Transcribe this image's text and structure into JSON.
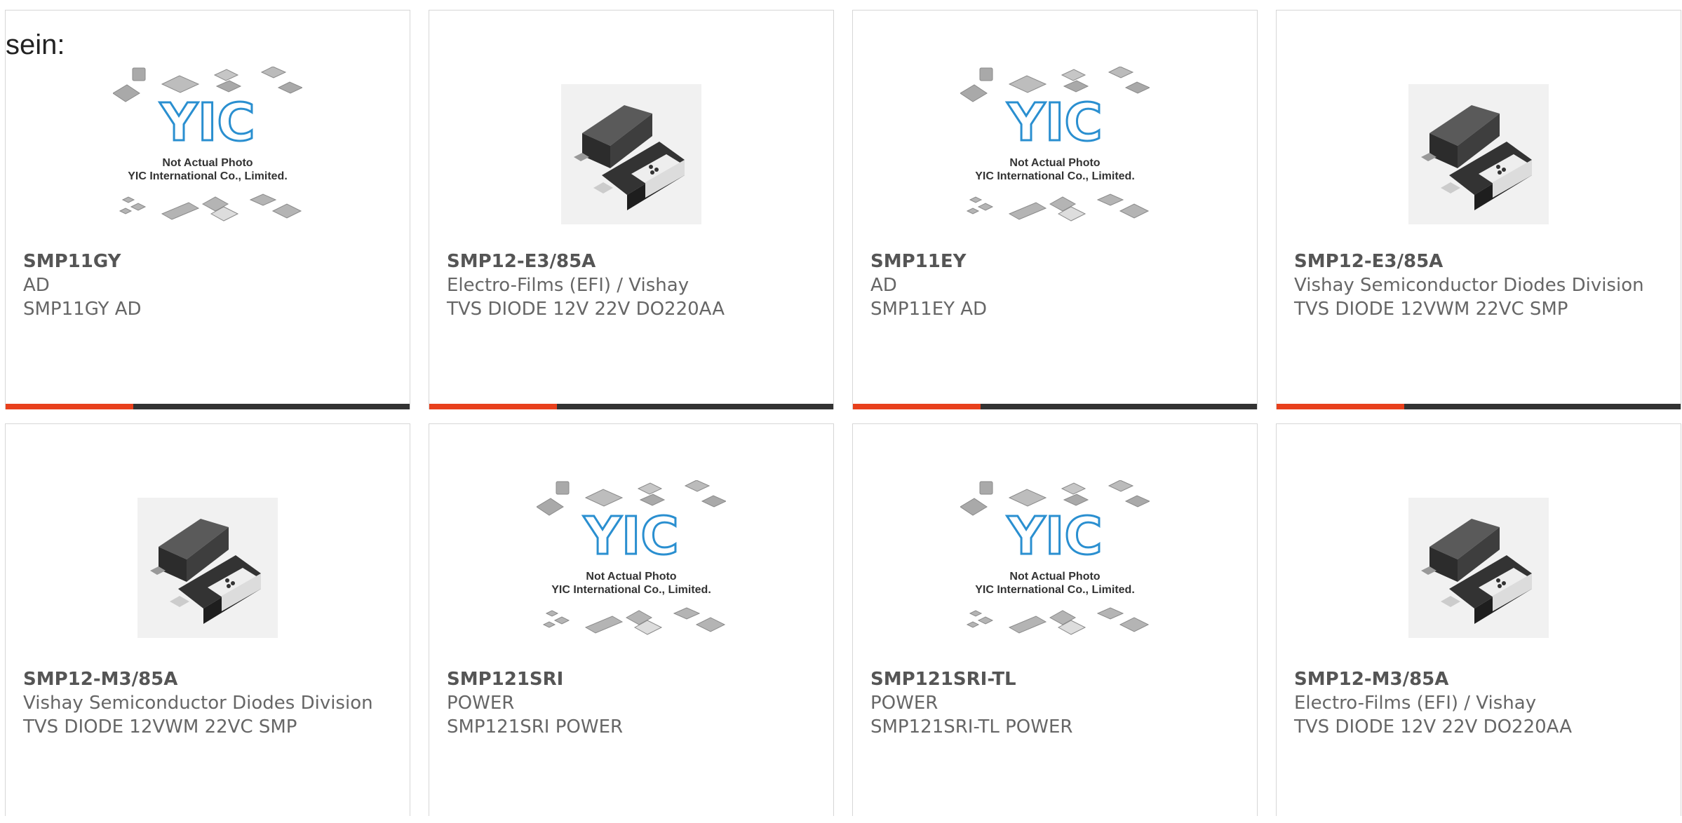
{
  "heading": "sein:",
  "products": [
    {
      "part": "SMP11GY",
      "manufacturer": "AD",
      "description": "SMP11GY AD",
      "image": "yic-placeholder-icon",
      "placeholder_line1": "Not Actual Photo",
      "placeholder_line2": "YIC International Co., Limited.",
      "logo": "YIC"
    },
    {
      "part": "SMP12-E3/85A",
      "manufacturer": "Electro-Films (EFI) / Vishay",
      "description": "TVS DIODE 12V 22V DO220AA",
      "image": "diode-package-icon"
    },
    {
      "part": "SMP11EY",
      "manufacturer": "AD",
      "description": "SMP11EY AD",
      "image": "yic-placeholder-icon",
      "placeholder_line1": "Not Actual Photo",
      "placeholder_line2": "YIC International Co., Limited.",
      "logo": "YIC"
    },
    {
      "part": "SMP12-E3/85A",
      "manufacturer": "Vishay Semiconductor Diodes Division",
      "description": "TVS DIODE 12VWM 22VC SMP",
      "image": "diode-package-icon"
    },
    {
      "part": "SMP12-M3/85A",
      "manufacturer": "Vishay Semiconductor Diodes Division",
      "description": "TVS DIODE 12VWM 22VC SMP",
      "image": "diode-package-icon"
    },
    {
      "part": "SMP121SRI",
      "manufacturer": "POWER",
      "description": "SMP121SRI POWER",
      "image": "yic-placeholder-icon",
      "placeholder_line1": "Not Actual Photo",
      "placeholder_line2": "YIC International Co., Limited.",
      "logo": "YIC"
    },
    {
      "part": "SMP121SRI-TL",
      "manufacturer": "POWER",
      "description": "SMP121SRI-TL POWER",
      "image": "yic-placeholder-icon",
      "placeholder_line1": "Not Actual Photo",
      "placeholder_line2": "YIC International Co., Limited.",
      "logo": "YIC"
    },
    {
      "part": "SMP12-M3/85A",
      "manufacturer": "Electro-Films (EFI) / Vishay",
      "description": "TVS DIODE 12V 22V DO220AA",
      "image": "diode-package-icon"
    }
  ],
  "colors": {
    "accent": "#e8401c",
    "bar": "#333333",
    "logo_blue": "#2a8fd0"
  }
}
